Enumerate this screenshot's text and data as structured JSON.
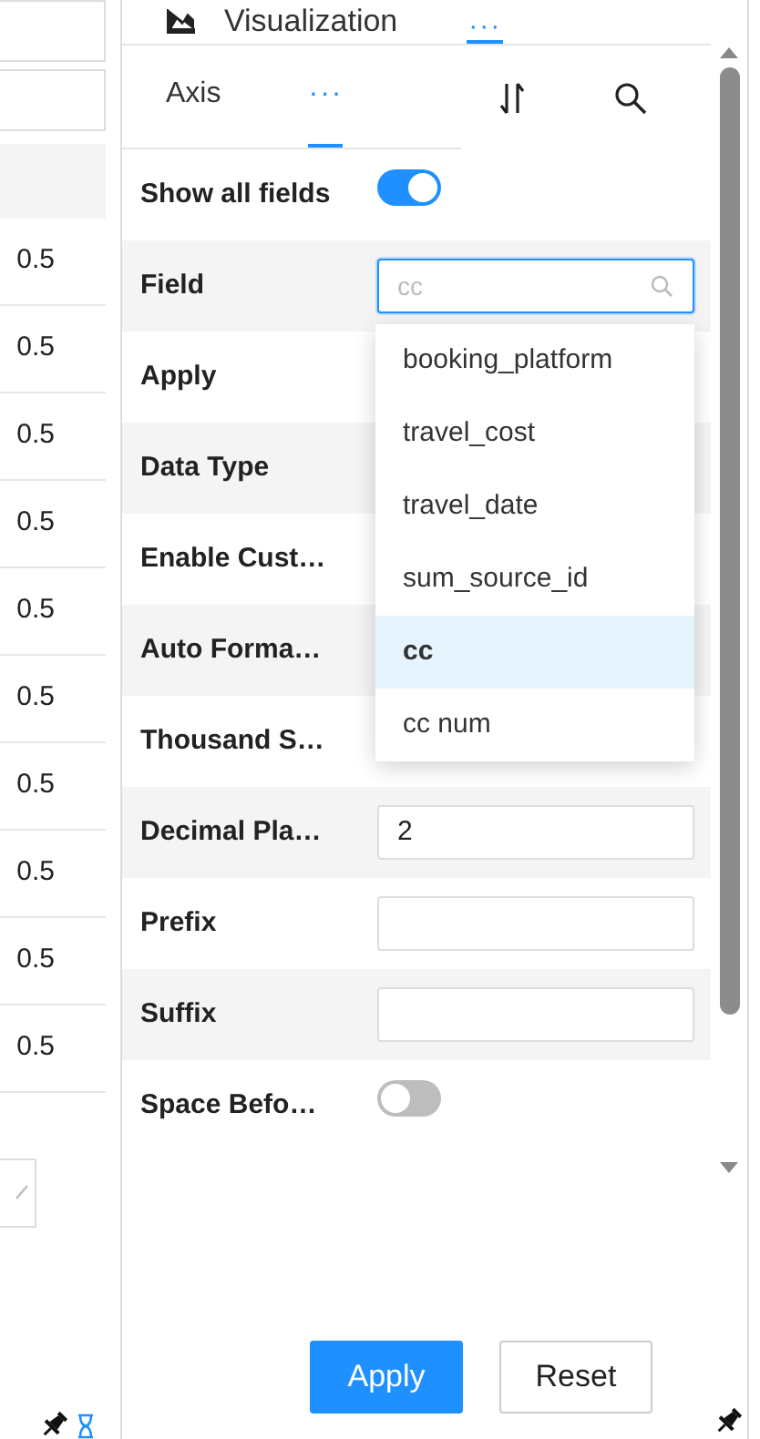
{
  "left_table": {
    "rows": [
      {
        "value": "0.5"
      },
      {
        "value": "0.5"
      },
      {
        "value": "0.5"
      },
      {
        "value": "0.5"
      },
      {
        "value": "0.5"
      },
      {
        "value": "0.5"
      },
      {
        "value": "0.5"
      },
      {
        "value": "0.5"
      },
      {
        "value": "0.5"
      },
      {
        "value": "0.5"
      }
    ]
  },
  "tabs": [
    {
      "label": "Visualization",
      "selected": false,
      "kind": "chart"
    },
    {
      "label": "···",
      "selected": true,
      "kind": "more"
    }
  ],
  "subtabs": [
    {
      "label": "Axis",
      "selected": false
    },
    {
      "label": "···",
      "selected": true
    }
  ],
  "properties": [
    {
      "label": "Show all fields",
      "kind": "toggle",
      "on": true
    },
    {
      "label": "Field",
      "kind": "search",
      "placeholder": "cc"
    },
    {
      "label": "Apply",
      "kind": "covered"
    },
    {
      "label": "Data Type",
      "kind": "covered"
    },
    {
      "label": "Enable Cust…",
      "kind": "covered"
    },
    {
      "label": "Auto Forma…",
      "kind": "covered"
    },
    {
      "label": "Thousand S…",
      "kind": "covered"
    },
    {
      "label": "Decimal Pla…",
      "kind": "input",
      "value": "2"
    },
    {
      "label": "Prefix",
      "kind": "input"
    },
    {
      "label": "Suffix",
      "kind": "input"
    },
    {
      "label": "Space Befo…",
      "kind": "toggle",
      "on": false
    }
  ],
  "dropdown": {
    "items": [
      {
        "label": "booking_platform",
        "selected": false
      },
      {
        "label": "travel_cost",
        "selected": false
      },
      {
        "label": "travel_date",
        "selected": false
      },
      {
        "label": "sum_source_id",
        "selected": false
      },
      {
        "label": "cc",
        "selected": true
      },
      {
        "label": "cc num",
        "selected": false
      }
    ]
  },
  "buttons": [
    {
      "label": "Apply",
      "kind": "primary"
    },
    {
      "label": "Reset",
      "kind": "secondary"
    }
  ]
}
